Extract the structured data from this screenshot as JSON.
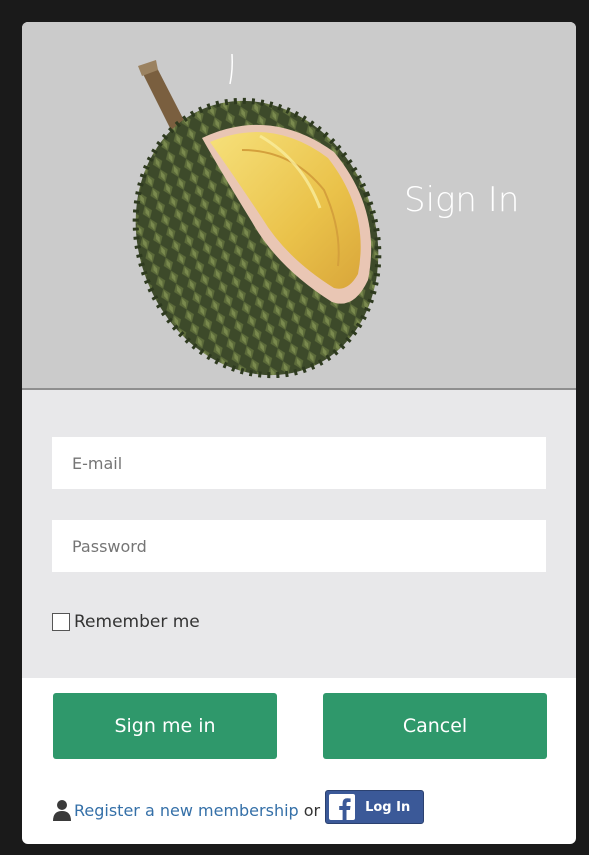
{
  "header": {
    "title": "Sign In",
    "image_icon": "durian-fruit-image"
  },
  "form": {
    "email_placeholder": "E-mail",
    "password_placeholder": "Password",
    "remember_label": "Remember me",
    "remember_checked": false
  },
  "buttons": {
    "sign_in_label": "Sign me in",
    "cancel_label": "Cancel",
    "primary_color": "#2f986b"
  },
  "footer": {
    "user_icon": "user-icon",
    "register_link": "Register a new membership",
    "or_text": "or",
    "facebook_label": "Log In",
    "facebook_icon": "facebook-icon",
    "facebook_color": "#3b5998"
  }
}
